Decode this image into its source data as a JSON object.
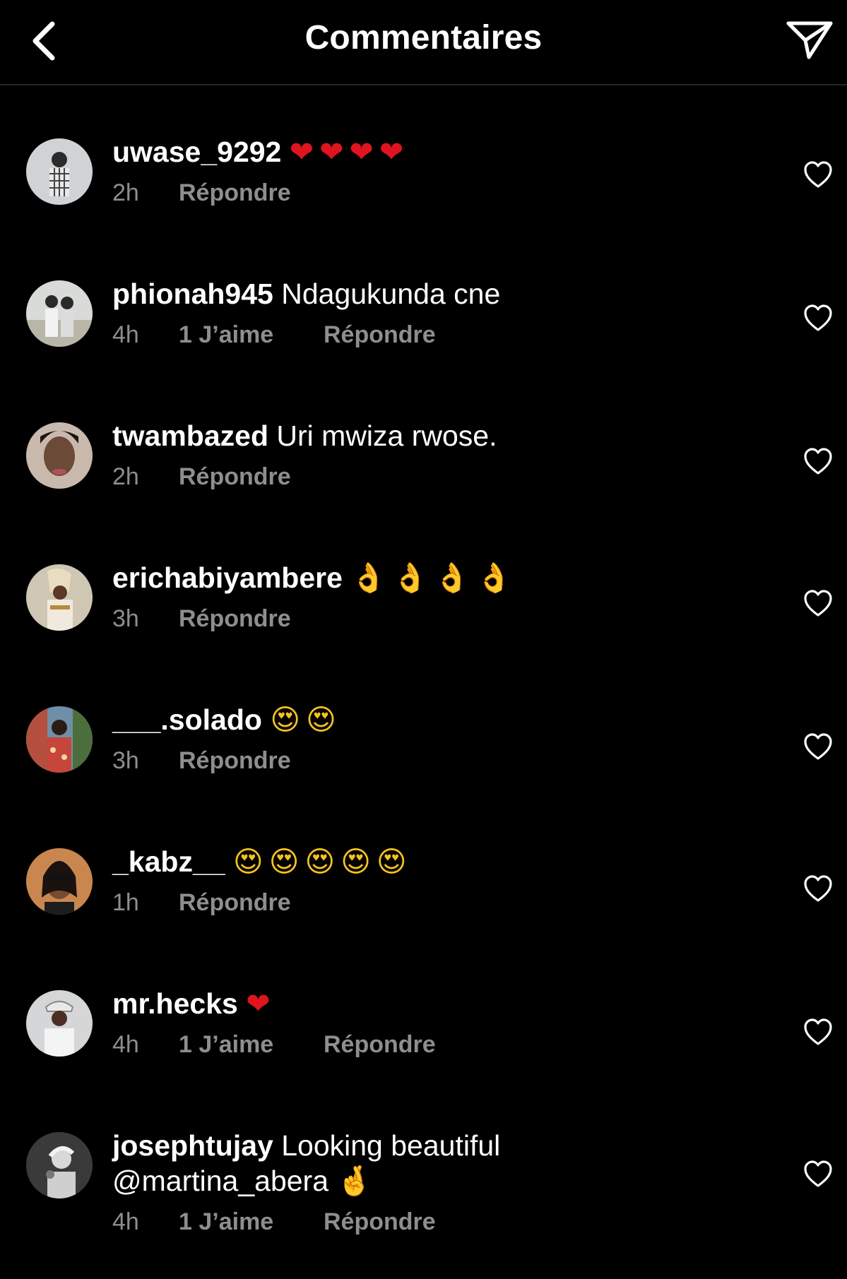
{
  "header": {
    "title": "Commentaires",
    "back_icon": "chevron-left-icon",
    "send_icon": "paper-plane-icon"
  },
  "colors": {
    "background": "#000000",
    "text": "#ffffff",
    "secondary_text": "#8e8e8e",
    "heart_emoji": "#e0141e"
  },
  "comments": [
    {
      "username": "uwase_9292",
      "text": "",
      "emoji": "❤❤❤❤",
      "time": "2h",
      "likes": "",
      "reply": "Répondre"
    },
    {
      "username": "phionah945",
      "text": "Ndagukunda cne",
      "emoji": "",
      "time": "4h",
      "likes": "1 J’aime",
      "reply": "Répondre"
    },
    {
      "username": "twambazed",
      "text": "Uri mwiza rwose.",
      "emoji": "",
      "time": "2h",
      "likes": "",
      "reply": "Répondre"
    },
    {
      "username": "erichabiyambere",
      "text": "",
      "emoji": "👌👌👌👌",
      "time": "3h",
      "likes": "",
      "reply": "Répondre"
    },
    {
      "username": "___.solado",
      "text": "",
      "emoji": "😍😍",
      "time": "3h",
      "likes": "",
      "reply": "Répondre"
    },
    {
      "username": "_kabz__",
      "text": "",
      "emoji": "😍😍😍😍😍",
      "time": "1h",
      "likes": "",
      "reply": "Répondre"
    },
    {
      "username": "mr.hecks",
      "text": "",
      "emoji": "❤",
      "time": "4h",
      "likes": "1 J’aime",
      "reply": "Répondre"
    },
    {
      "username": "josephtujay",
      "text": "Looking beautiful",
      "text2": "@martina_abera",
      "emoji": "🤞",
      "time": "4h",
      "likes": "1 J’aime",
      "reply": "Répondre"
    }
  ]
}
